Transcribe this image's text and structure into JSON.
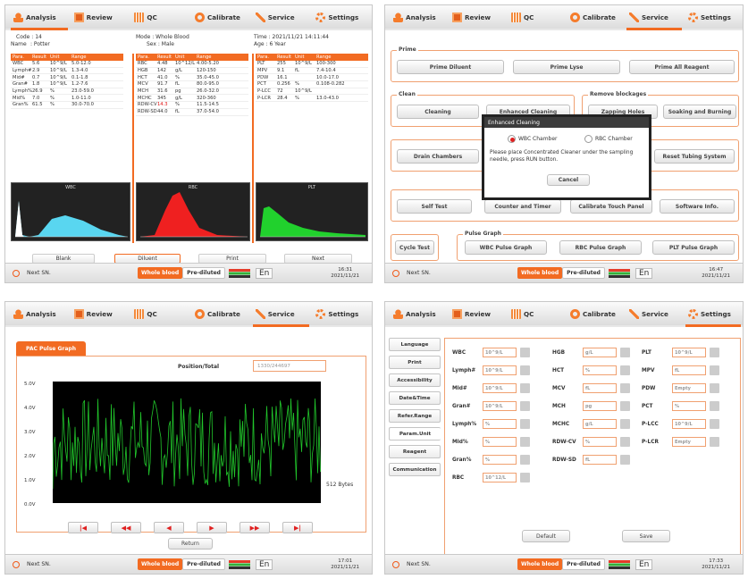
{
  "colors": {
    "accent": "#f26b22",
    "graph_green": "#21c62b",
    "dialog_header": "#3c3c3c"
  },
  "toolbar": [
    {
      "label": "Analysis",
      "icon": "analysis-icon"
    },
    {
      "label": "Review",
      "icon": "review-icon"
    },
    {
      "label": "QC",
      "icon": "qc-icon"
    },
    {
      "label": "Calibrate",
      "icon": "calibrate-icon"
    },
    {
      "label": "Service",
      "icon": "service-icon"
    },
    {
      "label": "Settings",
      "icon": "settings-icon"
    }
  ],
  "status": {
    "next_sn": "Next SN.",
    "mode_on": "Whole blood",
    "mode_off": "Pre-diluted",
    "lang": "En",
    "time1": "16:31",
    "date1": "2021/11/21",
    "time2": "16:47",
    "date2": "2021/11/21",
    "time3": "17:01",
    "date3": "2021/11/21",
    "time4": "17:33",
    "date4": "2021/11/21"
  },
  "analysis": {
    "code": "Code : 14",
    "mode": "Mode : Whole Blood",
    "time": "Time : 2021/11/21 14:11:44",
    "name_label": "Name",
    "name": ": Potter",
    "sex": "Sex : Male",
    "age": "Age : 6 Year",
    "headers": [
      "Para.",
      "Result",
      "Unit",
      "Range"
    ],
    "wbc_rows": [
      [
        "WBC",
        "5.6",
        "10^9/L",
        "5.0-12.0"
      ],
      [
        "Lymph#",
        "2.9",
        "10^9/L",
        "1.3-4.0"
      ],
      [
        "Mid#",
        "0.7",
        "10^9/L",
        "0.1-1.8"
      ],
      [
        "Gran#",
        "1.8",
        "10^9/L",
        "1.2-7.6"
      ],
      [
        "Lymph%",
        "26.9",
        "%",
        "23.0-59.0"
      ],
      [
        "Mid%",
        "7.0",
        "%",
        "1.0-11.0"
      ],
      [
        "Gran%",
        "61.5",
        "%",
        "30.0-70.0"
      ]
    ],
    "rbc_rows": [
      [
        "RBC",
        "4.48",
        "10^12/L",
        "4.00-5.20"
      ],
      [
        "HGB",
        "142",
        "g/L",
        "120-150"
      ],
      [
        "HCT",
        "41.0",
        "%",
        "35.0-45.0"
      ],
      [
        "MCV",
        "91.7",
        "fL",
        "80.0-95.0"
      ],
      [
        "MCH",
        "31.6",
        "pg",
        "26.0-32.0"
      ],
      [
        "MCHC",
        "345",
        "g/L",
        "320-360"
      ],
      [
        "RDW-CV",
        "14.3",
        "%",
        "11.5-14.5"
      ],
      [
        "RDW-SD",
        "44.0",
        "fL",
        "37.0-54.0"
      ]
    ],
    "plt_rows": [
      [
        "PLT",
        "255",
        "10^9/L",
        "100-300"
      ],
      [
        "MPV",
        "9.1",
        "fL",
        "7.4-10.4"
      ],
      [
        "PDW",
        "16.1",
        "",
        "10.0-17.0"
      ],
      [
        "PCT",
        "0.256",
        "%",
        "0.108-0.282"
      ],
      [
        "P-LCC",
        "72",
        "10^9/L",
        ""
      ],
      [
        "P-LCR",
        "28.4",
        "%",
        "13.0-43.0"
      ]
    ],
    "hist_titles": [
      "WBC",
      "RBC",
      "PLT"
    ],
    "buttons": [
      "Blank",
      "Diluent",
      "Print",
      "Next"
    ]
  },
  "service": {
    "prime_label": "Prime",
    "prime_buttons": [
      "Prime Diluent",
      "Prime Lyse",
      "Prime All Reagent"
    ],
    "clean_label": "Clean",
    "clean_buttons": [
      "Cleaning",
      "Enhanced Cleaning"
    ],
    "remove_label": "Remove blockages",
    "remove_buttons": [
      "Zapping Holes",
      "Soaking and Burning"
    ],
    "drain": "Drain Chambers",
    "reset": "Reset Tubing System",
    "row4": [
      "Self Test",
      "Counter and Timer",
      "Calibrate Touch Panel",
      "Software Info."
    ],
    "cycle": "Cycle Test",
    "pulse_label": "Pulse Graph",
    "pulse_buttons": [
      "WBC Pulse Graph",
      "RBC Pulse Graph",
      "PLT Pulse Graph"
    ],
    "dialog": {
      "title": "Enhanced Cleaning",
      "opt1": "WBC Chamber",
      "opt2": "RBC Chamber",
      "msg": "Please place Concentrated Cleaner under the sampling needle, press RUN button.",
      "cancel": "Cancel"
    }
  },
  "pulse": {
    "tab": "PAC Pulse Graph",
    "position_label": "Position/Total",
    "position_value": "1330/244697",
    "y_ticks": [
      "5.0V",
      "4.0V",
      "3.0V",
      "2.0V",
      "1.0V",
      "0.0V"
    ],
    "bytes": "512 Bytes",
    "nav": [
      "|◀",
      "◀◀",
      "◀",
      "▶",
      "▶▶",
      "▶|"
    ],
    "return": "Return"
  },
  "param": {
    "menu": [
      "Language",
      "Print",
      "Accessibility",
      "Date&Time",
      "Refer.Range",
      "Param.Unit",
      "Reagent",
      "Communication"
    ],
    "col1": [
      [
        "WBC",
        "10^9/L"
      ],
      [
        "Lymph#",
        "10^9/L"
      ],
      [
        "Mid#",
        "10^9/L"
      ],
      [
        "Gran#",
        "10^9/L"
      ],
      [
        "Lymph%",
        "%"
      ],
      [
        "Mid%",
        "%"
      ],
      [
        "Gran%",
        "%"
      ],
      [
        "RBC",
        "10^12/L"
      ]
    ],
    "col2": [
      [
        "HGB",
        "g/L"
      ],
      [
        "HCT",
        "%"
      ],
      [
        "MCV",
        "fL"
      ],
      [
        "MCH",
        "pg"
      ],
      [
        "MCHC",
        "g/L"
      ],
      [
        "RDW-CV",
        "%"
      ],
      [
        "RDW-SD",
        "fL"
      ]
    ],
    "col3": [
      [
        "PLT",
        "10^9/L"
      ],
      [
        "MPV",
        "fL"
      ],
      [
        "PDW",
        "Empty"
      ],
      [
        "PCT",
        "%"
      ],
      [
        "P-LCC",
        "10^9/L"
      ],
      [
        "P-LCR",
        "Empty"
      ]
    ],
    "default": "Default",
    "save": "Save"
  }
}
